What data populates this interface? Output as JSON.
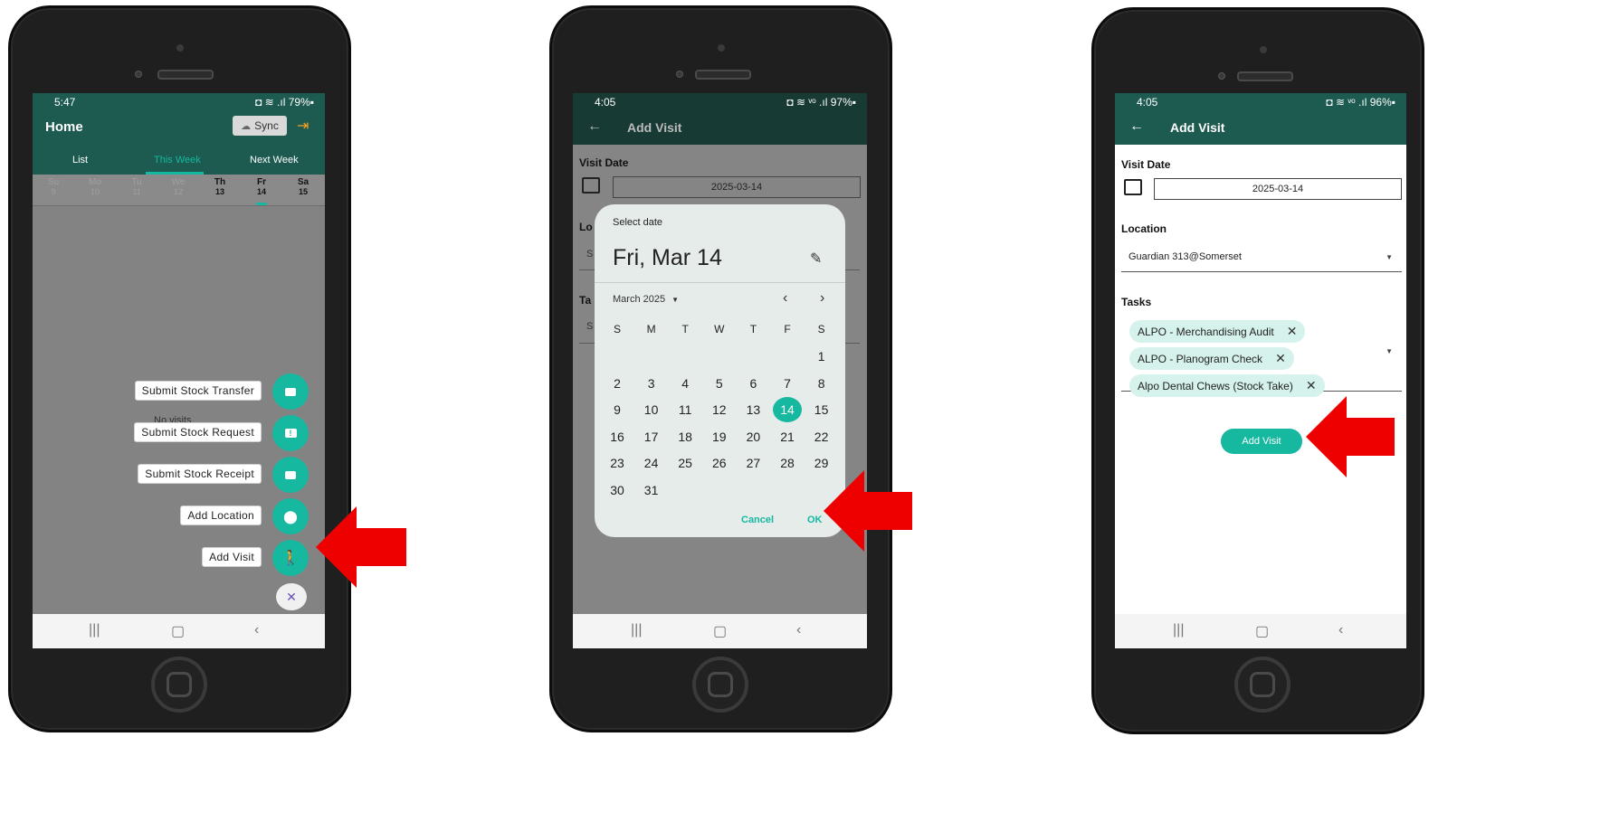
{
  "phone1": {
    "time": "5:47",
    "status_right": "◘ ≋ .ıl 79%▪",
    "title": "Home",
    "sync_label": "Sync",
    "tabs": [
      "List",
      "This Week",
      "Next Week"
    ],
    "days": [
      {
        "d": "Su",
        "n": "9"
      },
      {
        "d": "Mo",
        "n": "10"
      },
      {
        "d": "Tu",
        "n": "11"
      },
      {
        "d": "We",
        "n": "12"
      },
      {
        "d": "Th",
        "n": "13"
      },
      {
        "d": "Fr",
        "n": "14"
      },
      {
        "d": "Sa",
        "n": "15"
      }
    ],
    "empty_text": "No visits",
    "fab_actions": [
      {
        "label": "Submit Stock Transfer",
        "icon": "box-icon"
      },
      {
        "label": "Submit Stock Request",
        "icon": "request-icon"
      },
      {
        "label": "Submit Stock Receipt",
        "icon": "receipt-icon"
      },
      {
        "label": "Add Location",
        "icon": "location-pin-icon"
      },
      {
        "label": "Add Visit",
        "icon": "walking-person-icon"
      }
    ],
    "close_glyph": "✕"
  },
  "phone2": {
    "time": "4:05",
    "status_right": "◘ ≋ ᵛᵒ .ıl 97%▪",
    "title": "Add Visit",
    "visit_date_label": "Visit Date",
    "visit_date_value": "2025-03-14",
    "bg_partial_location": "Lo",
    "bg_partial_s1": "S",
    "bg_partial_tasks": "Ta",
    "bg_partial_s2": "S",
    "dialog": {
      "header": "Select date",
      "selected_label": "Fri, Mar 14",
      "month_label": "March 2025",
      "weekdays": [
        "S",
        "M",
        "T",
        "W",
        "T",
        "F",
        "S"
      ],
      "weeks": [
        [
          "",
          "",
          "",
          "",
          "",
          "",
          "1"
        ],
        [
          "2",
          "3",
          "4",
          "5",
          "6",
          "7",
          "8"
        ],
        [
          "9",
          "10",
          "11",
          "12",
          "13",
          "14",
          "15"
        ],
        [
          "16",
          "17",
          "18",
          "19",
          "20",
          "21",
          "22"
        ],
        [
          "23",
          "24",
          "25",
          "26",
          "27",
          "28",
          "29"
        ],
        [
          "30",
          "31",
          "",
          "",
          "",
          "",
          ""
        ]
      ],
      "selected_day": "14",
      "cancel": "Cancel",
      "ok": "OK"
    }
  },
  "phone3": {
    "time": "4:05",
    "status_right": "◘ ≋ ᵛᵒ .ıl 96%▪",
    "title": "Add Visit",
    "visit_date_label": "Visit Date",
    "visit_date_value": "2025-03-14",
    "location_label": "Location",
    "location_value": "Guardian 313@Somerset",
    "tasks_label": "Tasks",
    "tasks": [
      "ALPO - Merchandising Audit",
      "ALPO - Planogram Check",
      "Alpo Dental Chews (Stock Take)"
    ],
    "add_visit_button": "Add Visit"
  },
  "colors": {
    "app_bar": "#1d5a50",
    "accent": "#16b8a0",
    "arrow": "#ee0000",
    "dimmed_overlay": "#808080",
    "sync_bg": "#d9d9d9"
  }
}
